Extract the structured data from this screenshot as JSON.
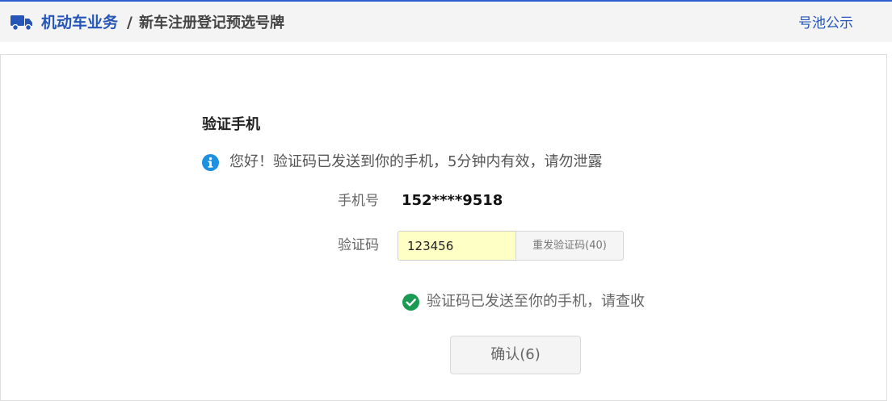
{
  "header": {
    "icon": "truck-icon",
    "breadcrumb_main": "机动车业务",
    "breadcrumb_separator": "/",
    "breadcrumb_sub": "新车注册登记预选号牌",
    "pool_link": "号池公示",
    "accent_color": "#2556b8"
  },
  "form": {
    "title": "验证手机",
    "info_icon": "info-icon",
    "info_message": "您好！验证码已发送到你的手机，5分钟内有效，请勿泄露",
    "phone_label": "手机号",
    "phone_value": "152****9518",
    "code_label": "验证码",
    "code_value": "123456",
    "resend_label": "重发验证码(40)",
    "success_icon": "check-circle-icon",
    "success_message": "验证码已发送至你的手机，请查收",
    "success_color": "#1a9a52",
    "confirm_label": "确认(6)"
  }
}
